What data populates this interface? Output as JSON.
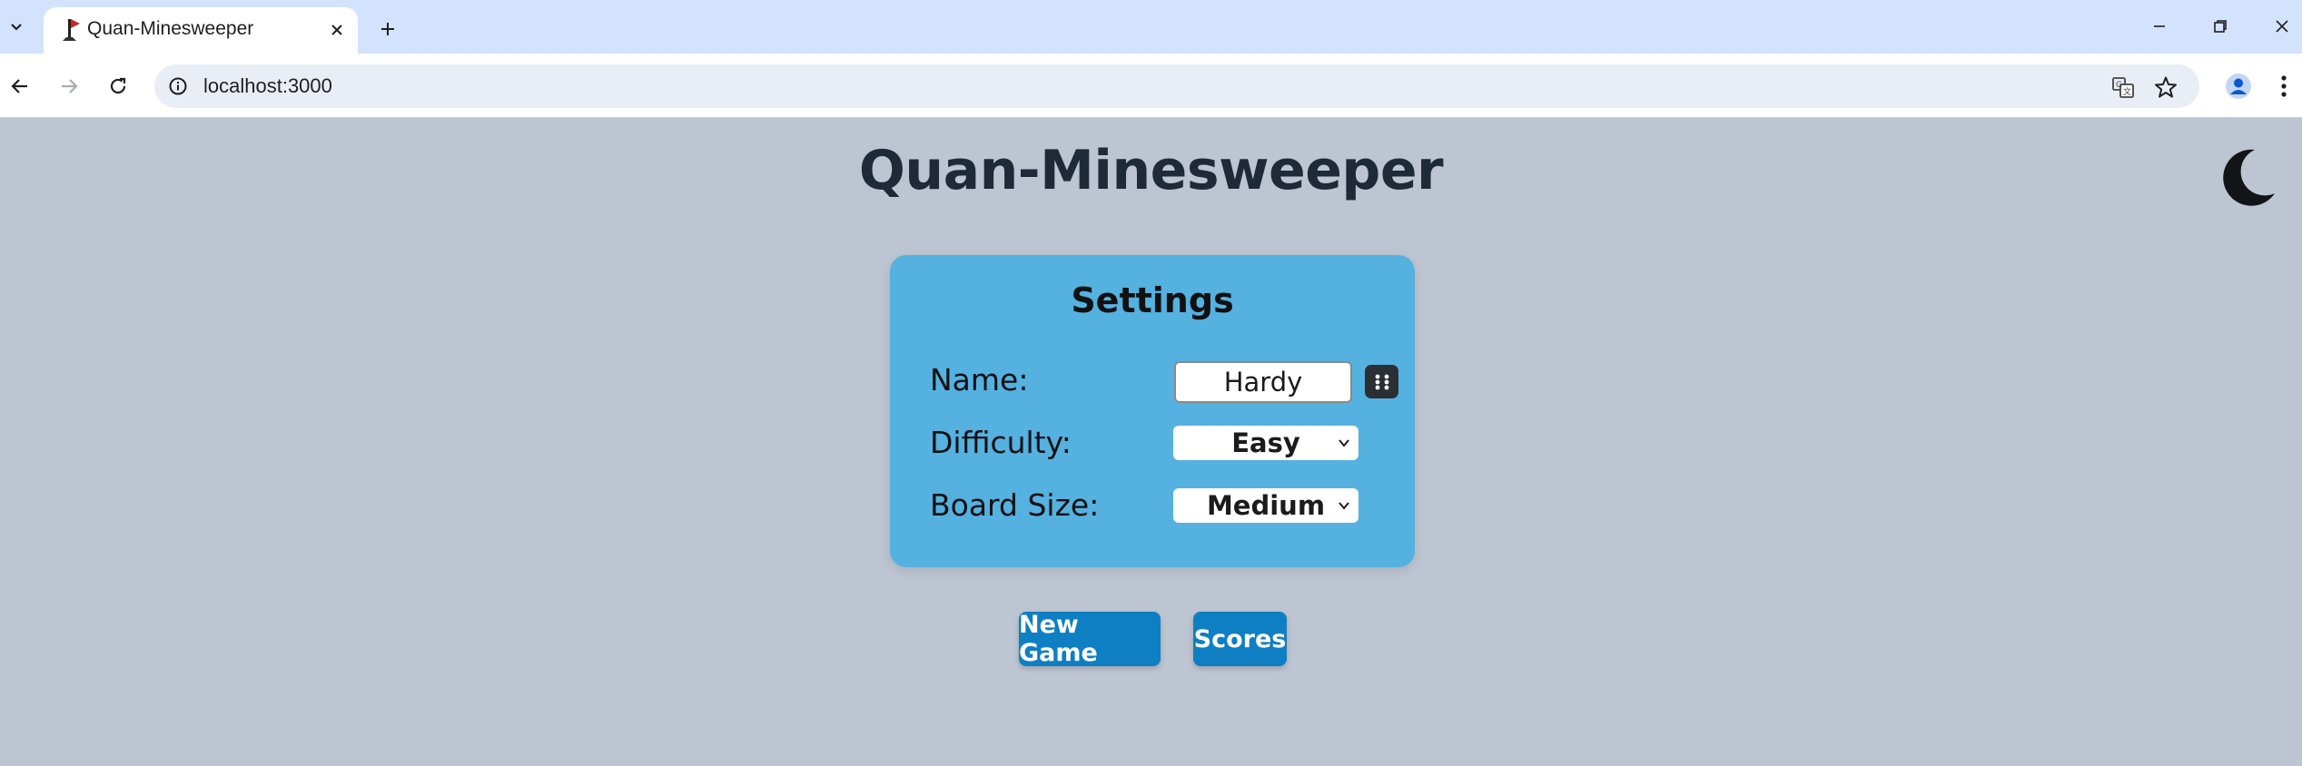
{
  "browser": {
    "tab": {
      "title": "Quan-Minesweeper",
      "favicon": "minesweeper-flag-icon"
    },
    "address_bar": {
      "url": "localhost:3000"
    },
    "colors": {
      "tabbar_bg": "#d3e3fd",
      "toolbar_bg": "#ffffff",
      "omnibox_bg": "#e9eef6"
    }
  },
  "page": {
    "title": "Quan-Minesweeper",
    "theme_toggle_icon": "moon-icon",
    "colors": {
      "background": "#bcc5d1",
      "card": "#54b1e0",
      "button": "#0e7fc3"
    }
  },
  "settings": {
    "title": "Settings",
    "name_label": "Name:",
    "name_value": "Hardy",
    "random_name_icon": "dice-icon",
    "difficulty_label": "Difficulty:",
    "difficulty_value": "Easy",
    "board_size_label": "Board Size:",
    "board_size_value": "Medium"
  },
  "actions": {
    "new_game_label": "New Game",
    "scores_label": "Scores"
  }
}
